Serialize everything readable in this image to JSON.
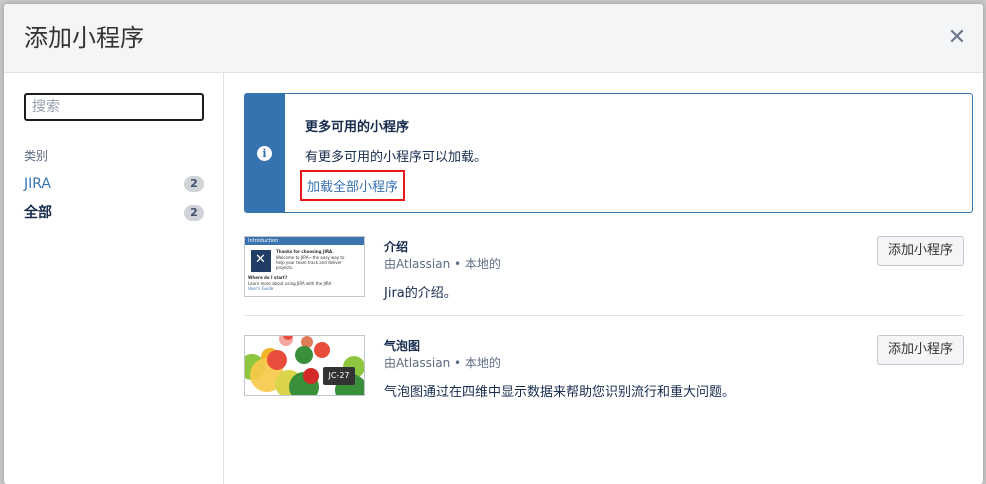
{
  "dialog": {
    "title": "添加小程序"
  },
  "sidebar": {
    "search_placeholder": "搜索",
    "category_heading": "类别",
    "categories": [
      {
        "label": "JIRA",
        "count": "2"
      },
      {
        "label": "全部",
        "count": "2"
      }
    ]
  },
  "notice": {
    "title": "更多可用的小程序",
    "text": "有更多可用的小程序可以加载。",
    "link": "加载全部小程序",
    "icon": "info-icon",
    "accent": "#3572b0"
  },
  "gadgets": [
    {
      "title": "介绍",
      "author": "由Atlassian • 本地的",
      "description": "Jira的介绍。",
      "button": "添加小程序",
      "thumb": {
        "header": "Introduction",
        "lines": [
          "Thanks for choosing JIRA.",
          "Welcome to JIRA—the easy way to",
          "help your team track and deliver",
          "projects.",
          "Where do I start?",
          "Learn more about using JIRA with the JIRA",
          "User's Guide"
        ]
      }
    },
    {
      "title": "气泡图",
      "author": "由Atlassian • 本地的",
      "description": "气泡图通过在四维中显示数据来帮助您识别流行和重大问题。",
      "button": "添加小程序",
      "thumb": {
        "tag": "JC-27"
      }
    }
  ]
}
